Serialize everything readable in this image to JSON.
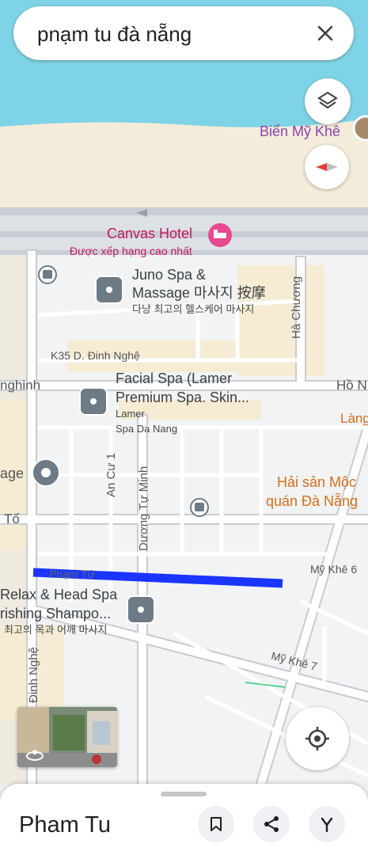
{
  "search": {
    "query": "pnạm tu đà nẵng"
  },
  "map": {
    "beach_label": "Biển Mỹ Khê",
    "hotel": {
      "name": "Canvas Hotel",
      "subtitle": "Được xếp hạng cao nhất"
    },
    "juno": {
      "line1": "Juno Spa &",
      "line2": "Massage 마사지 按摩",
      "line3": "다낭 최고의 헬스케어 마사지"
    },
    "facial": {
      "line1": "Facial Spa (Lamer",
      "line2": "Premium Spa. Skin...",
      "line3": "Lamer",
      "line4": "Spa Da Nang"
    },
    "relax": {
      "line1": "Relax & Head Spa",
      "line2": "rishing Shampo...",
      "line3": "최고의 목과 어깨 마사지"
    },
    "seafood": {
      "line1": "Hải sản Mộc",
      "line2": "quán Đà Nẵng"
    },
    "streets": {
      "k35": "K35 D. Đinh Nghệ",
      "ha_chuong": "Hà Chương",
      "an_cu": "An Cư 1",
      "duong_tu_minh": "Dương Tự Minh",
      "pham_tu": "Phạm Tứ",
      "my_khe_6": "Mỹ Khê 6",
      "my_khe_7": "Mỹ Khê 7",
      "dinh_nghe": "Đinh Nghệ",
      "ho_n": "Hồ N",
      "nghinh": "nghinh",
      "to": "Tố",
      "age": "age",
      "lang": "Làng"
    },
    "colors": {
      "water": "#7fd3e6",
      "route": "#1a35ff",
      "poi_gray": "#6d7b87",
      "hotel_pink": "#e8488e",
      "food_orange": "#d46f1a"
    }
  },
  "sheet": {
    "title": "Pham Tu"
  },
  "icons": [
    "close-icon",
    "layers-icon",
    "compass-icon",
    "my-location-icon",
    "bookmark-icon",
    "share-icon",
    "directions-icon",
    "street-view-rotate-icon"
  ]
}
